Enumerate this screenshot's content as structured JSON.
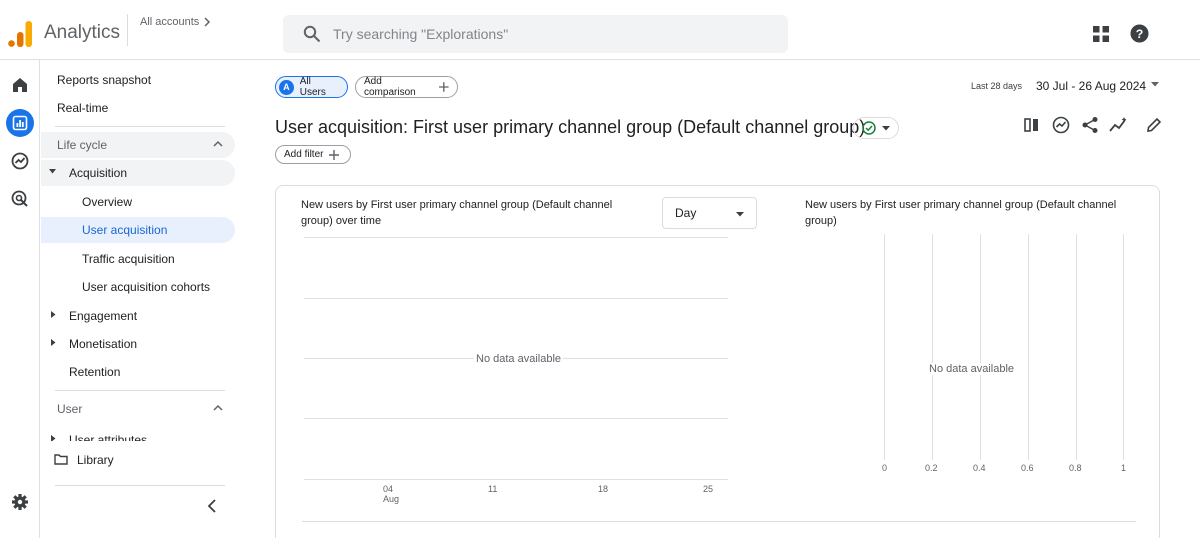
{
  "app": {
    "title": "Analytics",
    "all_accounts": "All accounts",
    "search_placeholder": "Try searching \"Explorations\""
  },
  "nav": {
    "reports_snapshot": "Reports snapshot",
    "realtime": "Real-time",
    "lifecycle": "Life cycle",
    "acquisition": "Acquisition",
    "overview": "Overview",
    "user_acquisition": "User acquisition",
    "traffic_acquisition": "Traffic acquisition",
    "user_acquisition_cohorts": "User acquisition cohorts",
    "engagement": "Engagement",
    "monetisation": "Monetisation",
    "retention": "Retention",
    "user_section": "User",
    "user_attributes": "User attributes",
    "library": "Library"
  },
  "main": {
    "segment_letter": "A",
    "segment_label": "All Users",
    "add_comparison": "Add comparison",
    "date_label": "Last 28 days",
    "date_range": "30 Jul - 26 Aug 2024",
    "title": "User acquisition: First user primary channel group (Default channel group)",
    "add_filter": "Add filter"
  },
  "cards": {
    "left_title": "New users by First user primary channel group (Default channel group) over time",
    "granularity": "Day",
    "left_no_data": "No data available",
    "x_ticks": [
      "04",
      "11",
      "18",
      "25"
    ],
    "x_month": "Aug",
    "right_title": "New users by First user primary channel group (Default channel group)",
    "right_no_data": "No data available",
    "right_ticks": [
      "0",
      "0.2",
      "0.4",
      "0.6",
      "0.8",
      "1"
    ]
  },
  "colors": {
    "accent": "#1a73e8",
    "selected_bg": "#e8f0fe",
    "logo_orange": "#f9ab00",
    "logo_dark_orange": "#e37400",
    "verified_green": "#188038"
  }
}
